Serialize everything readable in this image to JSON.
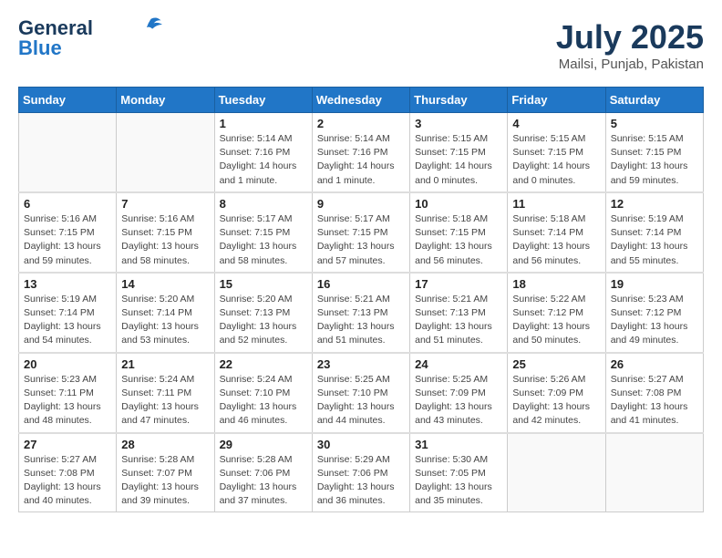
{
  "header": {
    "logo_line1": "General",
    "logo_line2": "Blue",
    "month": "July 2025",
    "location": "Mailsi, Punjab, Pakistan"
  },
  "weekdays": [
    "Sunday",
    "Monday",
    "Tuesday",
    "Wednesday",
    "Thursday",
    "Friday",
    "Saturday"
  ],
  "weeks": [
    [
      {
        "day": "",
        "info": ""
      },
      {
        "day": "",
        "info": ""
      },
      {
        "day": "1",
        "info": "Sunrise: 5:14 AM\nSunset: 7:16 PM\nDaylight: 14 hours\nand 1 minute."
      },
      {
        "day": "2",
        "info": "Sunrise: 5:14 AM\nSunset: 7:16 PM\nDaylight: 14 hours\nand 1 minute."
      },
      {
        "day": "3",
        "info": "Sunrise: 5:15 AM\nSunset: 7:15 PM\nDaylight: 14 hours\nand 0 minutes."
      },
      {
        "day": "4",
        "info": "Sunrise: 5:15 AM\nSunset: 7:15 PM\nDaylight: 14 hours\nand 0 minutes."
      },
      {
        "day": "5",
        "info": "Sunrise: 5:15 AM\nSunset: 7:15 PM\nDaylight: 13 hours\nand 59 minutes."
      }
    ],
    [
      {
        "day": "6",
        "info": "Sunrise: 5:16 AM\nSunset: 7:15 PM\nDaylight: 13 hours\nand 59 minutes."
      },
      {
        "day": "7",
        "info": "Sunrise: 5:16 AM\nSunset: 7:15 PM\nDaylight: 13 hours\nand 58 minutes."
      },
      {
        "day": "8",
        "info": "Sunrise: 5:17 AM\nSunset: 7:15 PM\nDaylight: 13 hours\nand 58 minutes."
      },
      {
        "day": "9",
        "info": "Sunrise: 5:17 AM\nSunset: 7:15 PM\nDaylight: 13 hours\nand 57 minutes."
      },
      {
        "day": "10",
        "info": "Sunrise: 5:18 AM\nSunset: 7:15 PM\nDaylight: 13 hours\nand 56 minutes."
      },
      {
        "day": "11",
        "info": "Sunrise: 5:18 AM\nSunset: 7:14 PM\nDaylight: 13 hours\nand 56 minutes."
      },
      {
        "day": "12",
        "info": "Sunrise: 5:19 AM\nSunset: 7:14 PM\nDaylight: 13 hours\nand 55 minutes."
      }
    ],
    [
      {
        "day": "13",
        "info": "Sunrise: 5:19 AM\nSunset: 7:14 PM\nDaylight: 13 hours\nand 54 minutes."
      },
      {
        "day": "14",
        "info": "Sunrise: 5:20 AM\nSunset: 7:14 PM\nDaylight: 13 hours\nand 53 minutes."
      },
      {
        "day": "15",
        "info": "Sunrise: 5:20 AM\nSunset: 7:13 PM\nDaylight: 13 hours\nand 52 minutes."
      },
      {
        "day": "16",
        "info": "Sunrise: 5:21 AM\nSunset: 7:13 PM\nDaylight: 13 hours\nand 51 minutes."
      },
      {
        "day": "17",
        "info": "Sunrise: 5:21 AM\nSunset: 7:13 PM\nDaylight: 13 hours\nand 51 minutes."
      },
      {
        "day": "18",
        "info": "Sunrise: 5:22 AM\nSunset: 7:12 PM\nDaylight: 13 hours\nand 50 minutes."
      },
      {
        "day": "19",
        "info": "Sunrise: 5:23 AM\nSunset: 7:12 PM\nDaylight: 13 hours\nand 49 minutes."
      }
    ],
    [
      {
        "day": "20",
        "info": "Sunrise: 5:23 AM\nSunset: 7:11 PM\nDaylight: 13 hours\nand 48 minutes."
      },
      {
        "day": "21",
        "info": "Sunrise: 5:24 AM\nSunset: 7:11 PM\nDaylight: 13 hours\nand 47 minutes."
      },
      {
        "day": "22",
        "info": "Sunrise: 5:24 AM\nSunset: 7:10 PM\nDaylight: 13 hours\nand 46 minutes."
      },
      {
        "day": "23",
        "info": "Sunrise: 5:25 AM\nSunset: 7:10 PM\nDaylight: 13 hours\nand 44 minutes."
      },
      {
        "day": "24",
        "info": "Sunrise: 5:25 AM\nSunset: 7:09 PM\nDaylight: 13 hours\nand 43 minutes."
      },
      {
        "day": "25",
        "info": "Sunrise: 5:26 AM\nSunset: 7:09 PM\nDaylight: 13 hours\nand 42 minutes."
      },
      {
        "day": "26",
        "info": "Sunrise: 5:27 AM\nSunset: 7:08 PM\nDaylight: 13 hours\nand 41 minutes."
      }
    ],
    [
      {
        "day": "27",
        "info": "Sunrise: 5:27 AM\nSunset: 7:08 PM\nDaylight: 13 hours\nand 40 minutes."
      },
      {
        "day": "28",
        "info": "Sunrise: 5:28 AM\nSunset: 7:07 PM\nDaylight: 13 hours\nand 39 minutes."
      },
      {
        "day": "29",
        "info": "Sunrise: 5:28 AM\nSunset: 7:06 PM\nDaylight: 13 hours\nand 37 minutes."
      },
      {
        "day": "30",
        "info": "Sunrise: 5:29 AM\nSunset: 7:06 PM\nDaylight: 13 hours\nand 36 minutes."
      },
      {
        "day": "31",
        "info": "Sunrise: 5:30 AM\nSunset: 7:05 PM\nDaylight: 13 hours\nand 35 minutes."
      },
      {
        "day": "",
        "info": ""
      },
      {
        "day": "",
        "info": ""
      }
    ]
  ]
}
